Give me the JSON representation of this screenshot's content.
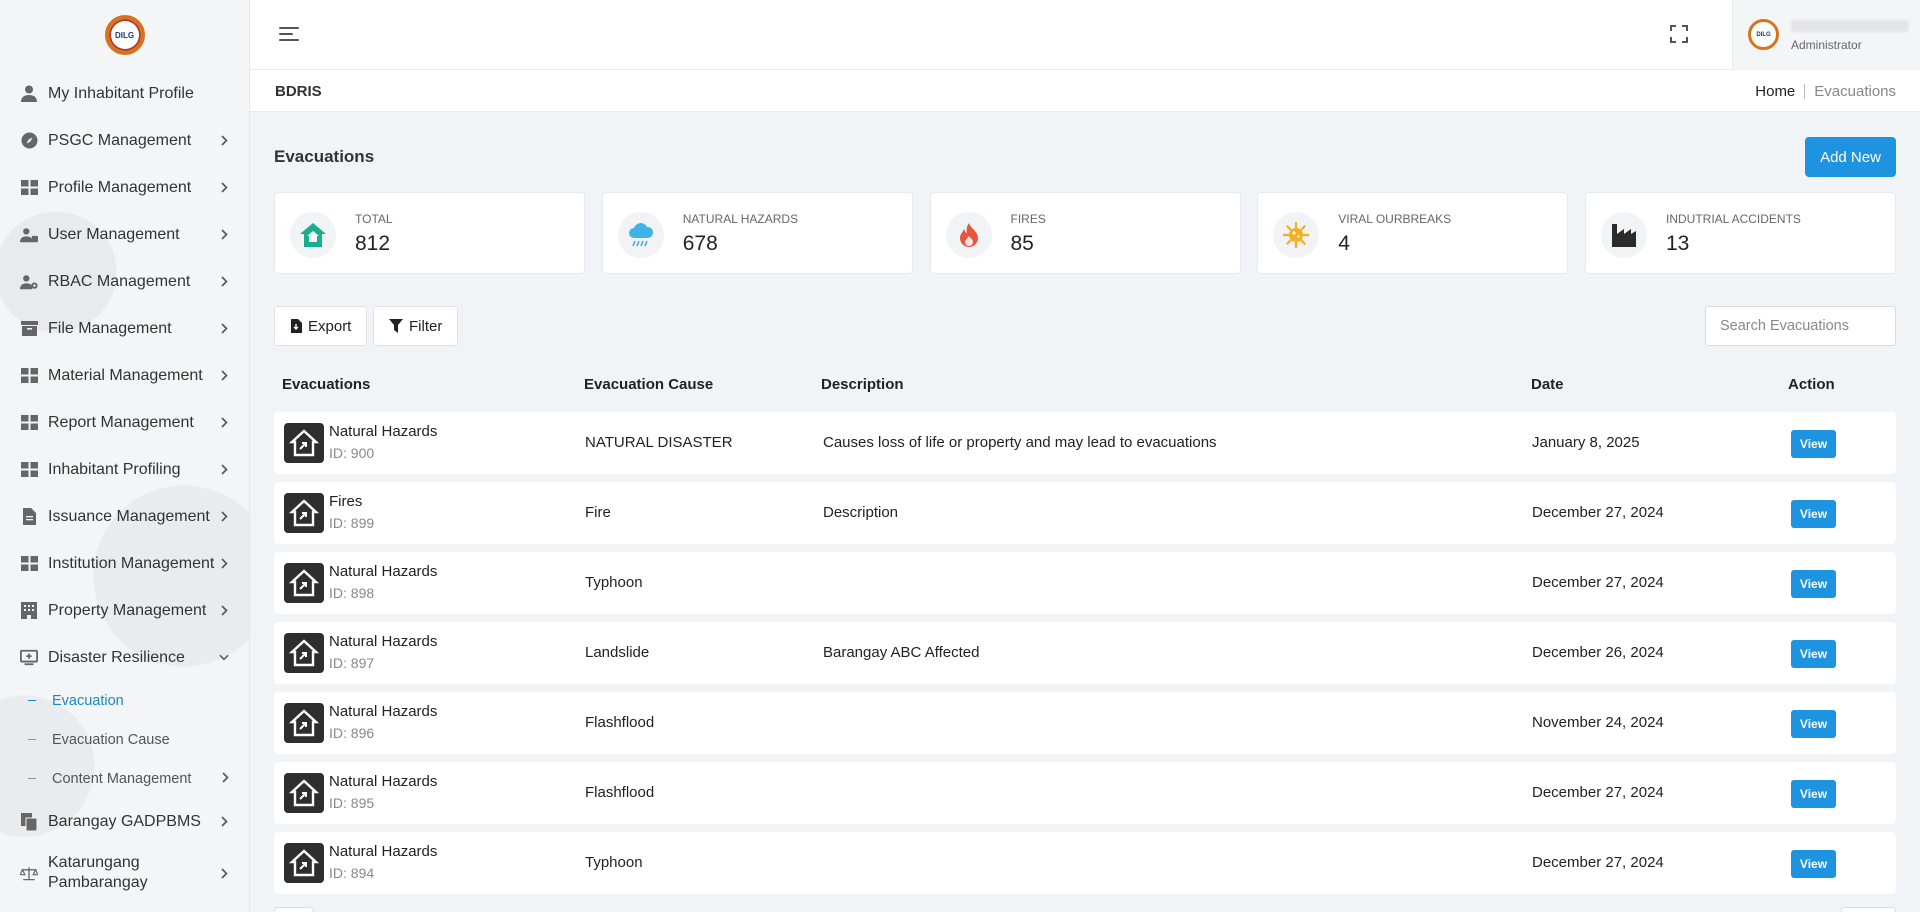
{
  "logo": {
    "text": "DILG"
  },
  "sidebar": {
    "items": [
      {
        "label": "My Inhabitant Profile",
        "icon": "user-icon",
        "chevron": false
      },
      {
        "label": "PSGC Management",
        "icon": "compass-icon",
        "chevron": true
      },
      {
        "label": "Profile Management",
        "icon": "grid-icon",
        "chevron": true
      },
      {
        "label": "User Management",
        "icon": "users-icon",
        "chevron": true
      },
      {
        "label": "RBAC Management",
        "icon": "user-gear-icon",
        "chevron": true
      },
      {
        "label": "File Management",
        "icon": "archive-icon",
        "chevron": true
      },
      {
        "label": "Material Management",
        "icon": "grid-icon",
        "chevron": true
      },
      {
        "label": "Report Management",
        "icon": "grid-icon",
        "chevron": true
      },
      {
        "label": "Inhabitant Profiling",
        "icon": "grid-icon",
        "chevron": true
      },
      {
        "label": "Issuance Management",
        "icon": "file-icon",
        "chevron": true
      },
      {
        "label": "Institution Management",
        "icon": "grid-icon",
        "chevron": true
      },
      {
        "label": "Property Management",
        "icon": "building-icon",
        "chevron": true
      },
      {
        "label": "Disaster Resilience",
        "icon": "monitor-plus-icon",
        "chevron": true,
        "expanded": true
      }
    ],
    "sub_items": [
      {
        "label": "Evacuation",
        "active": true,
        "chevron": false
      },
      {
        "label": "Evacuation Cause",
        "active": false,
        "chevron": false
      },
      {
        "label": "Content Management",
        "active": false,
        "chevron": true
      }
    ],
    "items_after": [
      {
        "label": "Barangay GADPBMS",
        "icon": "copy-icon",
        "chevron": true
      },
      {
        "label": "Katarungang Pambarangay",
        "icon": "scale-icon",
        "chevron": true
      }
    ]
  },
  "header": {
    "profile_role": "Administrator",
    "avatar_text": "DILG"
  },
  "breadcrumb": {
    "app": "BDRIS",
    "home": "Home",
    "current": "Evacuations"
  },
  "page": {
    "title": "Evacuations",
    "add_new": "Add New"
  },
  "stats": [
    {
      "label": "TOTAL",
      "value": "812",
      "icon": "house-icon",
      "color": "#1aae8c"
    },
    {
      "label": "NATURAL HAZARDS",
      "value": "678",
      "icon": "cloud-rain-icon",
      "color": "#3fb3e6"
    },
    {
      "label": "FIRES",
      "value": "85",
      "icon": "fire-icon",
      "color": "#e8553a"
    },
    {
      "label": "VIRAL OURBREAKS",
      "value": "4",
      "icon": "virus-icon",
      "color": "#f2b01e"
    },
    {
      "label": "INDUTRIAL ACCIDENTS",
      "value": "13",
      "icon": "industry-icon",
      "color": "#2b2b2b"
    }
  ],
  "toolbar": {
    "export": "Export",
    "filter": "Filter",
    "search_placeholder": "Search Evacuations"
  },
  "table": {
    "headers": [
      "Evacuations",
      "Evacuation Cause",
      "Description",
      "Date",
      "Action"
    ],
    "rows": [
      {
        "name": "Natural Hazards",
        "id": "ID: 900",
        "cause": "NATURAL DISASTER",
        "description": "Causes loss of life or property and may lead to evacuations",
        "date": "January 8, 2025",
        "action": "View"
      },
      {
        "name": "Fires",
        "id": "ID: 899",
        "cause": "Fire",
        "description": "Description",
        "date": "December 27, 2024",
        "action": "View"
      },
      {
        "name": "Natural Hazards",
        "id": "ID: 898",
        "cause": "Typhoon",
        "description": "",
        "date": "December 27, 2024",
        "action": "View"
      },
      {
        "name": "Natural Hazards",
        "id": "ID: 897",
        "cause": "Landslide",
        "description": "Barangay ABC Affected",
        "date": "December 26, 2024",
        "action": "View"
      },
      {
        "name": "Natural Hazards",
        "id": "ID: 896",
        "cause": "Flashflood",
        "description": "",
        "date": "November 24, 2024",
        "action": "View"
      },
      {
        "name": "Natural Hazards",
        "id": "ID: 895",
        "cause": "Flashflood",
        "description": "",
        "date": "December 27, 2024",
        "action": "View"
      },
      {
        "name": "Natural Hazards",
        "id": "ID: 894",
        "cause": "Typhoon",
        "description": "",
        "date": "December 27, 2024",
        "action": "View"
      }
    ]
  },
  "colors": {
    "accent": "#1e94e0",
    "active_nav": "#1e88c7"
  }
}
